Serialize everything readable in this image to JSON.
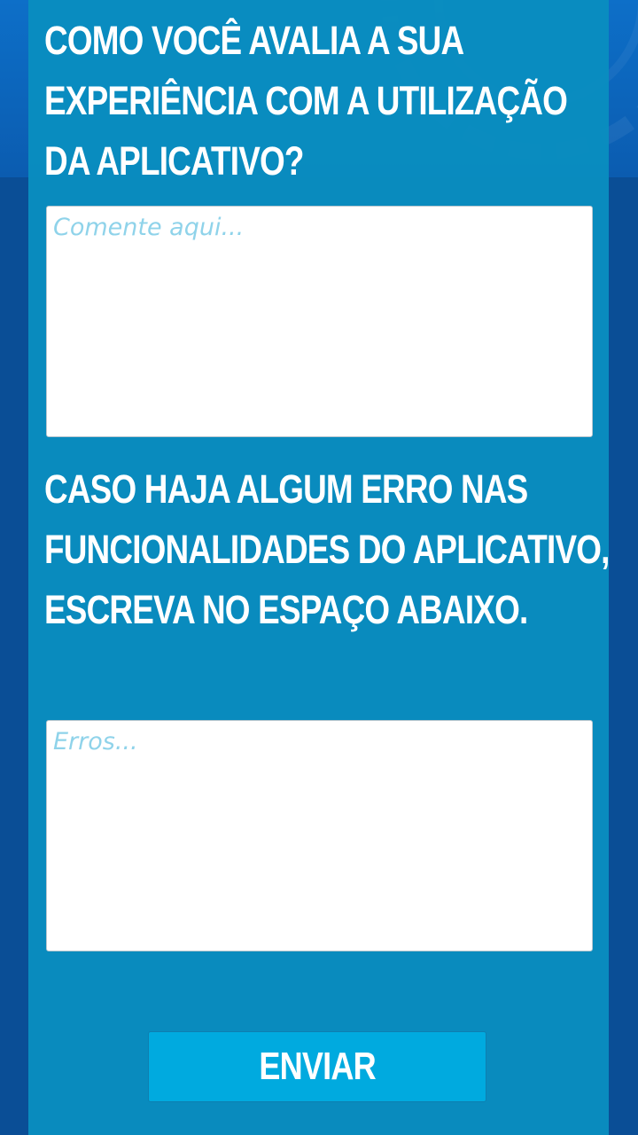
{
  "colors": {
    "background": "#0a4e96",
    "panel": "#098ec0",
    "button": "#00aadf",
    "placeholder": "#8fd3ea",
    "text": "#ffffff"
  },
  "form": {
    "experience_question_lines": [
      "COMO VOCÊ AVALIA A SUA",
      "EXPERIÊNCIA COM A UTILIZAÇÃO",
      "DA APLICATIVO?"
    ],
    "comment_field": {
      "value": "",
      "placeholder": "Comente aqui..."
    },
    "error_question_lines": [
      "CASO HAJA ALGUM ERRO NAS",
      "FUNCIONALIDADES DO APLICATIVO,",
      "ESCREVA NO ESPAÇO ABAIXO."
    ],
    "errors_field": {
      "value": "",
      "placeholder": "Erros..."
    },
    "submit_label": "ENVIAR"
  }
}
